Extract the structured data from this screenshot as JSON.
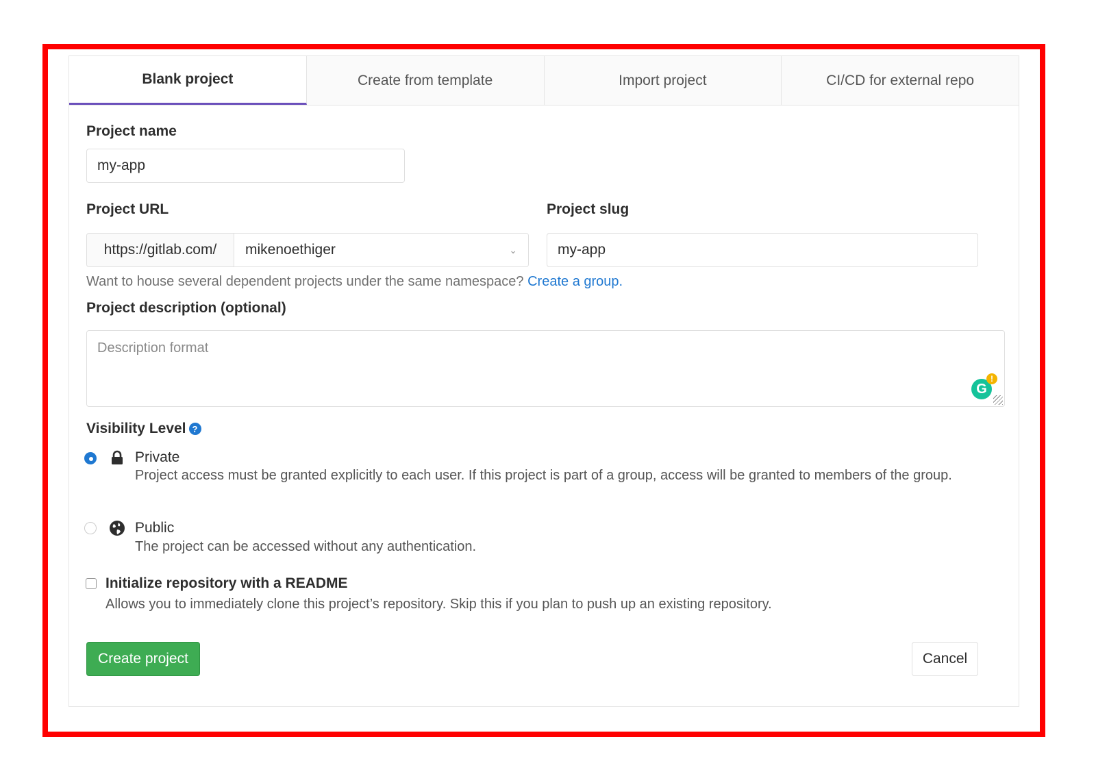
{
  "tabs": [
    {
      "label": "Blank project",
      "active": true
    },
    {
      "label": "Create from template",
      "active": false
    },
    {
      "label": "Import project",
      "active": false
    },
    {
      "label": "CI/CD for external repo",
      "active": false
    }
  ],
  "form": {
    "project_name_label": "Project name",
    "project_name_value": "my-app",
    "project_url_label": "Project URL",
    "url_prefix": "https://gitlab.com/",
    "namespace_value": "mikenoethiger",
    "project_slug_label": "Project slug",
    "project_slug_value": "my-app",
    "help_text": "Want to house several dependent projects under the same namespace? ",
    "help_link": "Create a group.",
    "description_label": "Project description (optional)",
    "description_placeholder": "Description format"
  },
  "visibility": {
    "label": "Visibility Level",
    "options": [
      {
        "title": "Private",
        "description": "Project access must be granted explicitly to each user. If this project is part of a group, access will be granted to members of the group.",
        "selected": true,
        "icon": "lock-icon"
      },
      {
        "title": "Public",
        "description": "The project can be accessed without any authentication.",
        "selected": false,
        "icon": "globe-icon"
      }
    ]
  },
  "readme": {
    "label": "Initialize repository with a README",
    "description": "Allows you to immediately clone this project’s repository. Skip this if you plan to push up an existing repository.",
    "checked": false
  },
  "actions": {
    "create_label": "Create project",
    "cancel_label": "Cancel"
  },
  "colors": {
    "accent_tab": "#6b4fbb",
    "primary_button": "#3eac53",
    "link": "#1f78d1",
    "highlight_frame": "#ff0000"
  }
}
